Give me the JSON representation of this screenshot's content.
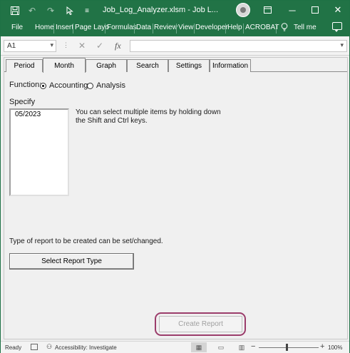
{
  "window": {
    "title": "Job_Log_Analyzer.xlsm  -  Job L...",
    "accent_color": "#217346"
  },
  "titlebar": {
    "icons": [
      "save-icon",
      "undo-icon",
      "redo-icon",
      "pointer-icon",
      "customize-icon"
    ],
    "controls": [
      "ribbon-display-icon",
      "minimize-icon",
      "maximize-icon",
      "close-icon"
    ]
  },
  "ribbon": {
    "tabs": [
      "File",
      "Home",
      "Insert",
      "Page Layo",
      "Formulas",
      "Data",
      "Review",
      "View",
      "Developer",
      "Help",
      "ACROBAT"
    ],
    "tell_me": "Tell me"
  },
  "formula_bar": {
    "name_box": "A1",
    "formula": ""
  },
  "form": {
    "tabs": [
      "Period",
      "Month",
      "Graph",
      "Search",
      "Settings",
      "Information"
    ],
    "active_tab": "Month",
    "function_label": "Function:",
    "function_options": [
      "Accounting",
      "Analysis"
    ],
    "function_selected": "Accounting",
    "specify_label": "Specify",
    "list_items": [
      "05/2023"
    ],
    "hint": "You can select multiple items by holding down the Shift and Ctrl keys.",
    "type_label": "Type of report to be created can be set/changed.",
    "select_button": "Select Report Type",
    "create_button": "Create Report",
    "create_enabled": false
  },
  "status_bar": {
    "ready": "Ready",
    "accessibility": "Accessibility: Investigate",
    "zoom": "100%"
  }
}
